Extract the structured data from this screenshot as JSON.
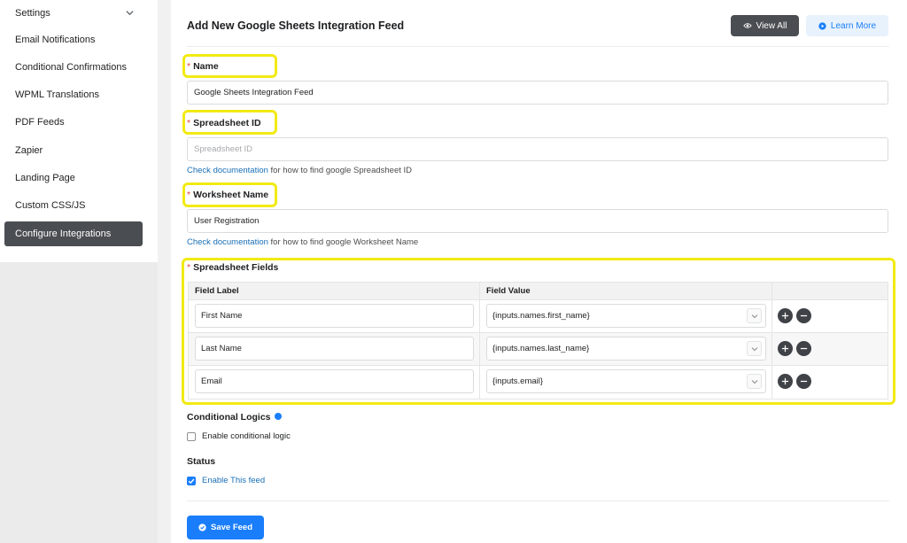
{
  "sidebar": {
    "items": [
      {
        "label": "Settings",
        "has_chevron": true
      },
      {
        "label": "Email Notifications"
      },
      {
        "label": "Conditional Confirmations"
      },
      {
        "label": "WPML Translations"
      },
      {
        "label": "PDF Feeds"
      },
      {
        "label": "Zapier"
      },
      {
        "label": "Landing Page"
      },
      {
        "label": "Custom CSS/JS"
      },
      {
        "label": "Configure Integrations",
        "active": true
      }
    ]
  },
  "header": {
    "title": "Add New Google Sheets Integration Feed",
    "view_all_label": "View All",
    "learn_more_label": "Learn More"
  },
  "form": {
    "required_marker": "*",
    "name": {
      "label": "Name",
      "value": "Google Sheets Integration Feed"
    },
    "spreadsheet_id": {
      "label": "Spreadsheet ID",
      "placeholder": "Spreadsheet ID",
      "help_link": "Check documentation",
      "help_text": " for how to find google Spreadsheet ID"
    },
    "worksheet_name": {
      "label": "Worksheet Name",
      "value": "User Registration",
      "help_link": "Check documentation",
      "help_text": " for how to find google Worksheet Name"
    },
    "spreadsheet_fields": {
      "label": "Spreadsheet Fields",
      "col_label": "Field Label",
      "col_value": "Field Value",
      "rows": [
        {
          "label": "First Name",
          "value": "{inputs.names.first_name}"
        },
        {
          "label": "Last Name",
          "value": "{inputs.names.last_name}"
        },
        {
          "label": "Email",
          "value": "{inputs.email}"
        }
      ]
    },
    "conditional_logics": {
      "label": "Conditional Logics",
      "checkbox_label": "Enable conditional logic",
      "checked": false
    },
    "status": {
      "label": "Status",
      "checkbox_label": "Enable This feed",
      "checked": true
    },
    "save_label": "Save Feed"
  },
  "colors": {
    "highlight": "#f2ea13",
    "accent": "#1a7efb",
    "dark_button": "#4a4d52",
    "required": "#e34444"
  }
}
